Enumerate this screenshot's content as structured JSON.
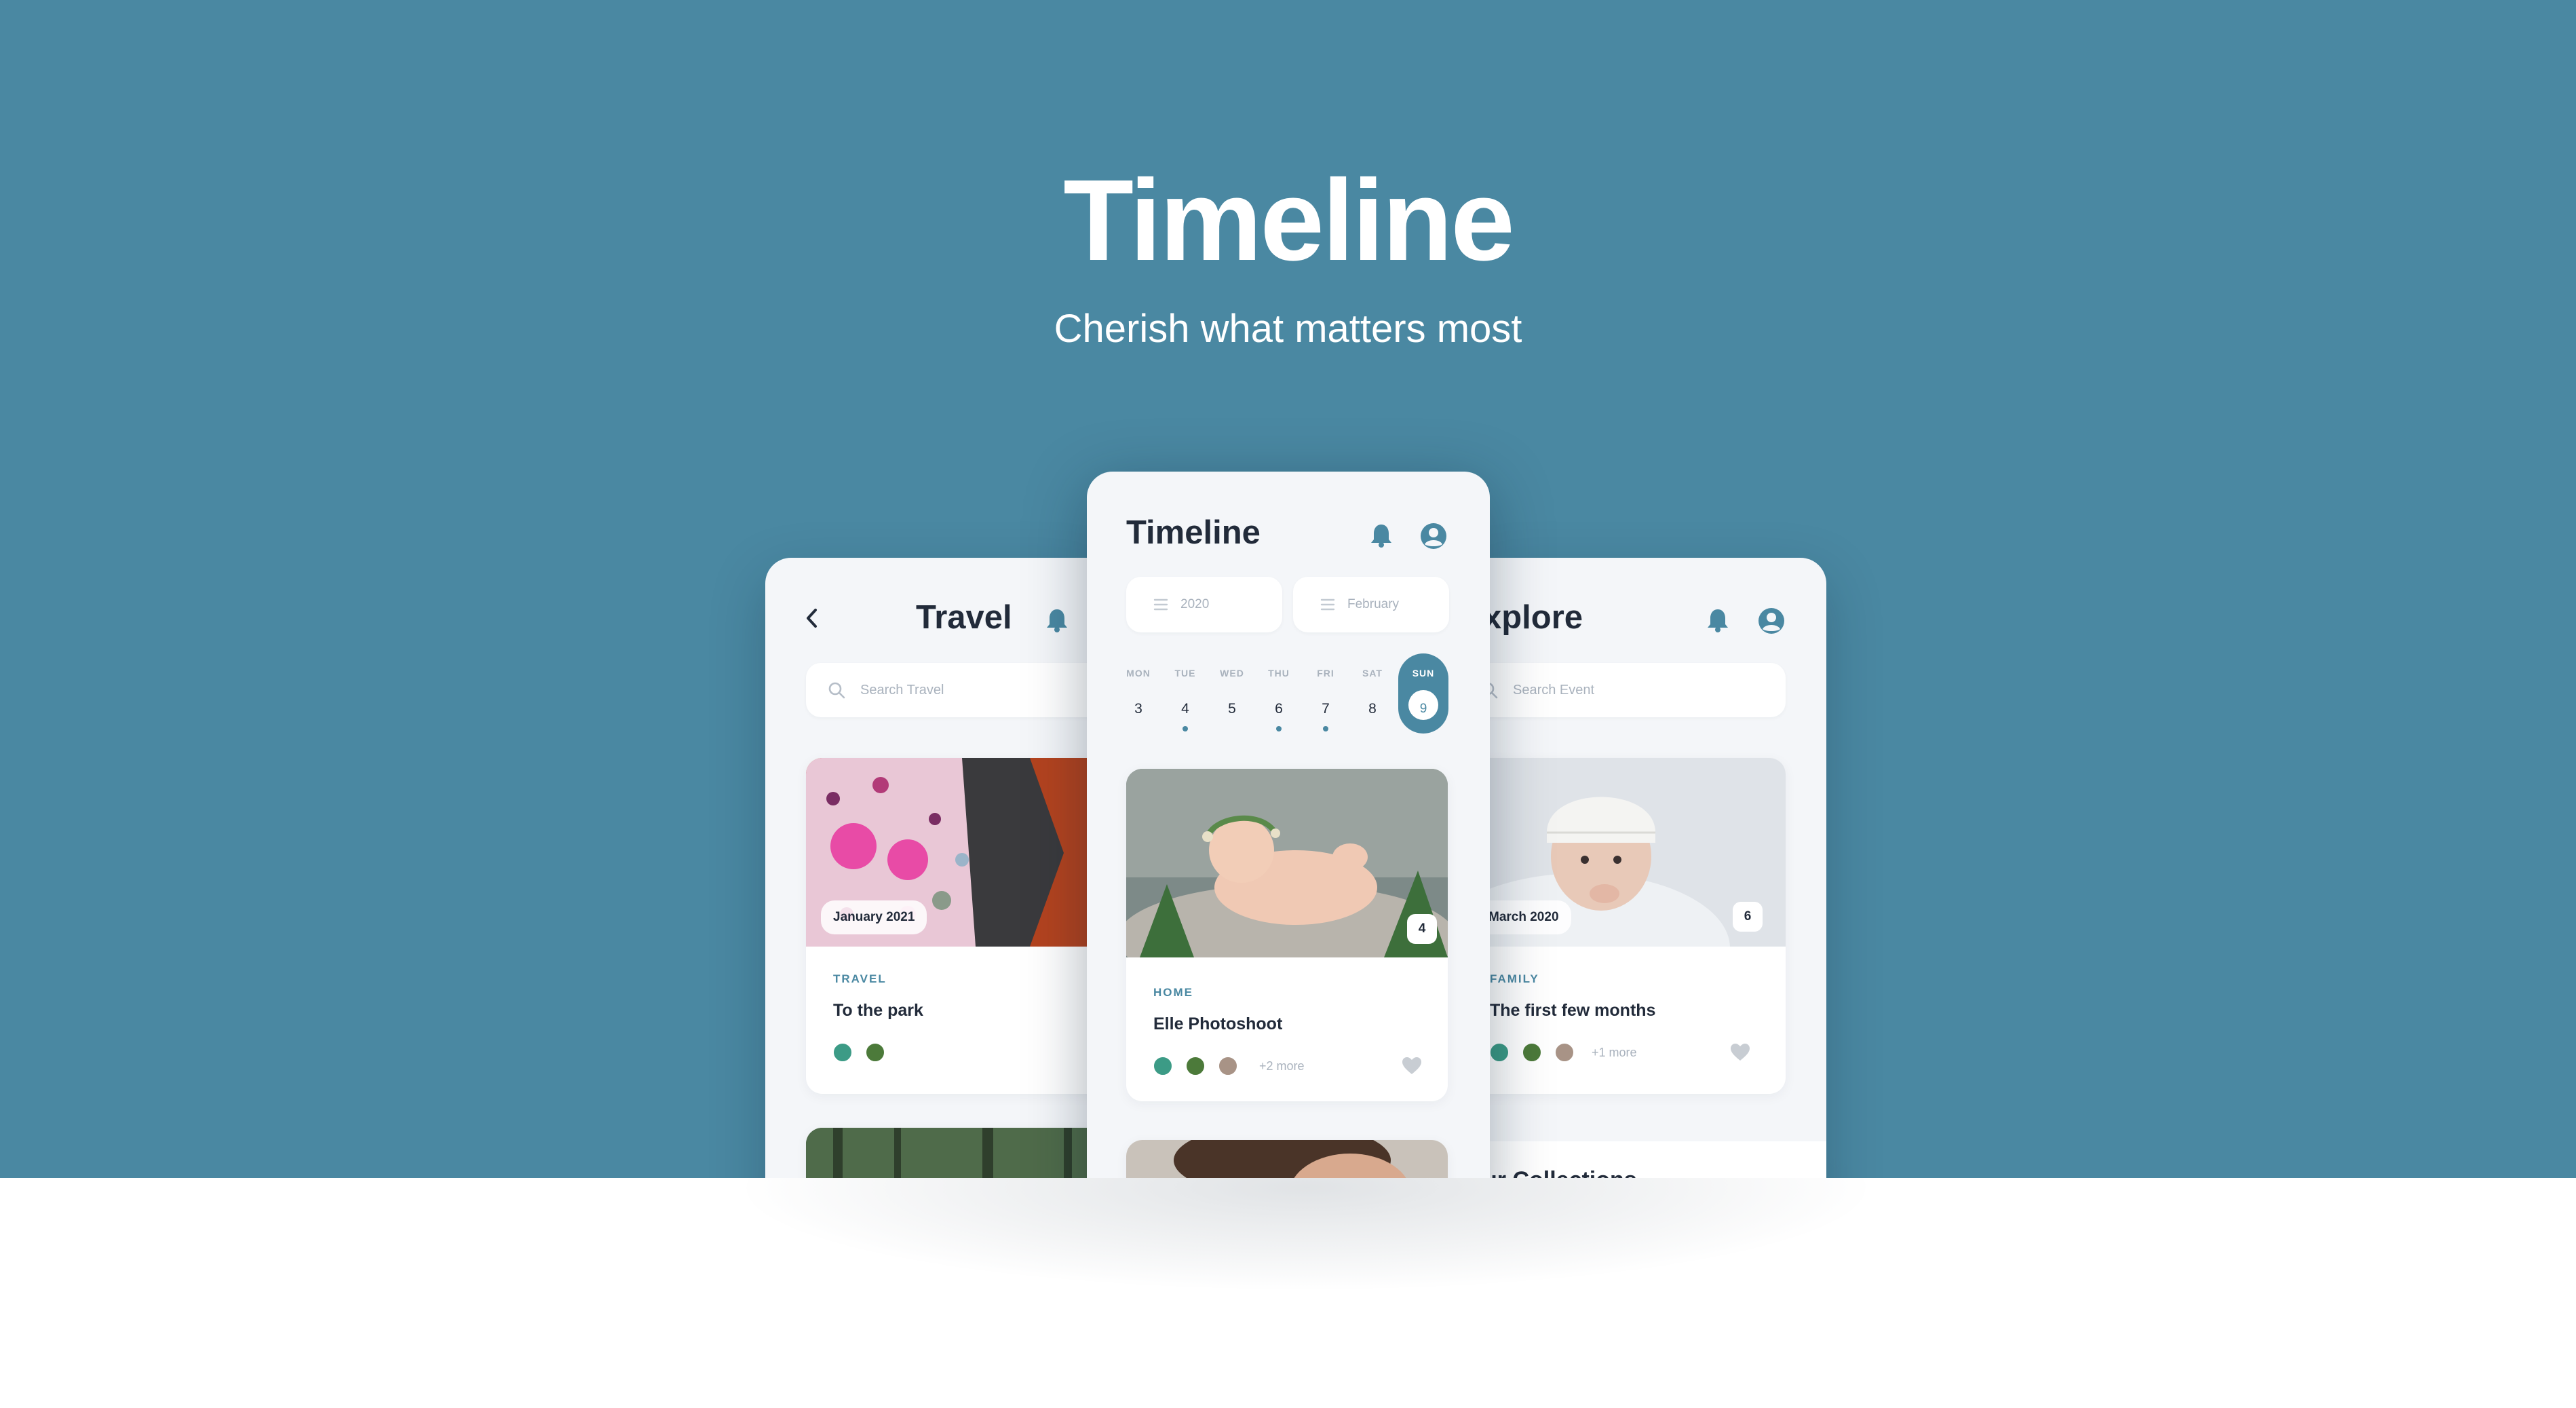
{
  "hero": {
    "title": "Timeline",
    "tagline": "Cherish what matters most"
  },
  "colors": {
    "brand": "#4a88a2",
    "text_dark": "#222b3a",
    "text_muted": "#a9b2bd",
    "screen_bg": "#f4f6f9"
  },
  "screens": {
    "travel": {
      "title": "Travel",
      "search_placeholder": "Search Travel",
      "card1": {
        "date": "January 2021",
        "category": "TRAVEL",
        "title": "To the park"
      }
    },
    "timeline": {
      "title": "Timeline",
      "year_selector": "2020",
      "month_selector": "February",
      "week": [
        {
          "name": "MON",
          "date": "3"
        },
        {
          "name": "TUE",
          "date": "4"
        },
        {
          "name": "WED",
          "date": "5"
        },
        {
          "name": "THU",
          "date": "6"
        },
        {
          "name": "FRI",
          "date": "7"
        },
        {
          "name": "SAT",
          "date": "8"
        },
        {
          "name": "SUN",
          "date": "9"
        }
      ],
      "card1": {
        "count": "4",
        "category": "HOME",
        "title": "Elle Photoshoot",
        "more": "+2 more"
      }
    },
    "explore": {
      "title": "Explore",
      "title_visible": "xplore",
      "search_placeholder": "Search Event",
      "card1": {
        "date": "March 2020",
        "count": "6",
        "category": "FAMILY",
        "title": "The first few months",
        "more": "+1 more"
      },
      "collections_heading_visible": "ur Collections"
    }
  }
}
